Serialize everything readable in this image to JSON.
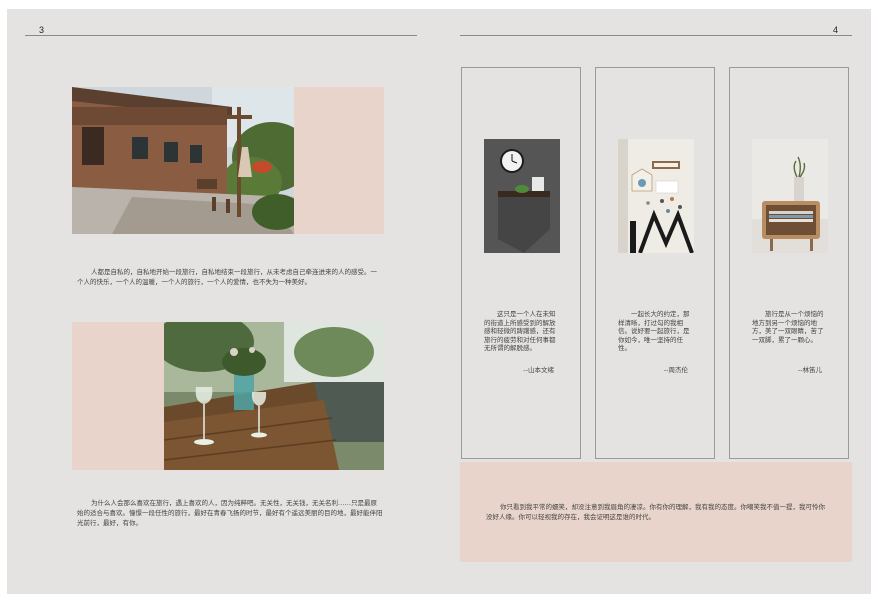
{
  "left_page": {
    "page_number": "3",
    "paragraph_1": "人都是自私的，自私地开始一段旅行，自私地结束一段旅行，从未考虑自己牵连进来的人的感受。一个人的快乐，一个人的温暖，一个人的旅行，一个人的爱情，也不失为一种美好。",
    "paragraph_2": "为什么人会那么喜欢在旅行，遇上喜欢的人，因为纯粹吧。无关性，无关钱，无关名利……只是最原始的适合与喜欢。憧憬一段任性的旅行，最好在青春飞扬的时节，最好有个遥远美丽的目的地，最好能伴阳光前行，最好，有你。"
  },
  "right_page": {
    "page_number": "4",
    "cards": [
      {
        "quote": "这只是一个人在未知的街道上所感受到的解放感和轻微的踌躇感，还有旅行的疲劳和对任何事都无所谓的解脱感。",
        "author": "--山本文绪"
      },
      {
        "quote": "一起长大的约定，那样清晰，打过勾的我相信。说好要一起旅行，是你如今，唯一坚持的任性。",
        "author": "--周杰伦"
      },
      {
        "quote": "旅行是从一个烦恼的地方到另一个烦恼的地方，美了一双眼睛，苦了一双脚，累了一颗心。",
        "author": "--林笛儿"
      }
    ],
    "note": "你只看到我平常的蠕笑，却没注意到我眉角的凄凉。你有你的理解，我有我的态度。你嘲笑我不值一提，我可怜你没好人缘。你可以轻视我的存在，我会证明这是谁的时代。"
  },
  "colors": {
    "background": "#e4e3e1",
    "pink": "#e8d4cb",
    "rule": "#8a8a8a"
  }
}
